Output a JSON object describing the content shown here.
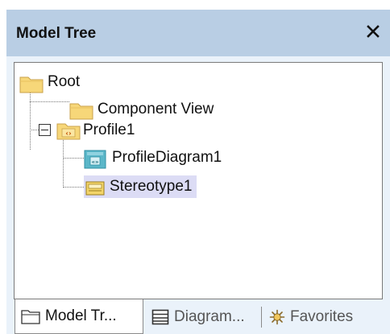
{
  "panel": {
    "title": "Model Tree",
    "close_glyph": "✕"
  },
  "tree": {
    "root": {
      "label": "Root",
      "icon": "folder-icon"
    },
    "component_view": {
      "label": "Component View",
      "icon": "folder-icon"
    },
    "profile1": {
      "label": "Profile1",
      "icon": "profile-package-icon",
      "expanded": true
    },
    "profile_diagram1": {
      "label": "ProfileDiagram1",
      "icon": "profile-diagram-icon"
    },
    "stereotype1": {
      "label": "Stereotype1",
      "icon": "stereotype-icon",
      "selected": true
    }
  },
  "tabs": [
    {
      "label": "Model Tr...",
      "icon": "folder-icon",
      "active": true
    },
    {
      "label": "Diagram...",
      "icon": "diagram-list-icon",
      "active": false
    },
    {
      "label": "Favorites",
      "icon": "favorites-star-icon",
      "active": false
    }
  ],
  "colors": {
    "title_bar": "#b9cee4",
    "panel_bg": "#eaf2fa",
    "selection": "#dcdcf5",
    "folder_fill": "#f7d779",
    "diagram_fill": "#5bb7c9"
  }
}
